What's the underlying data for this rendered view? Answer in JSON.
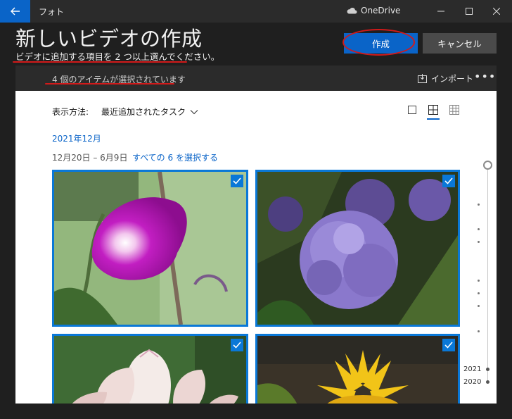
{
  "titlebar": {
    "app_name": "フォト",
    "onedrive_label": "OneDrive"
  },
  "header": {
    "title": "新しいビデオの作成",
    "subtitle": "ビデオに追加する項目を 2 つ以上選んでください。",
    "create_label": "作成",
    "cancel_label": "キャンセル"
  },
  "selection_bar": {
    "count_text": "4 個のアイテムが選択されています",
    "import_label": "インポート",
    "more_label": "•••"
  },
  "toolbar": {
    "view_label": "表示方法:",
    "view_value": "最近追加されたタスク"
  },
  "gallery": {
    "month": "2021年12月",
    "date_range": "12月20日 – 6月9日",
    "select_all": "すべての 6 を選択する",
    "photos": [
      {
        "subject": "morning-glory",
        "selected": true
      },
      {
        "subject": "hydrangea",
        "selected": true
      },
      {
        "subject": "lotus",
        "selected": true
      },
      {
        "subject": "sunflower",
        "selected": true
      }
    ]
  },
  "timeline": {
    "years": [
      "2021",
      "2020"
    ]
  },
  "colors": {
    "accent": "#0a64c8",
    "annotation_red": "#d21a1a",
    "background": "#1f1f1f",
    "panel": "#ffffff"
  }
}
